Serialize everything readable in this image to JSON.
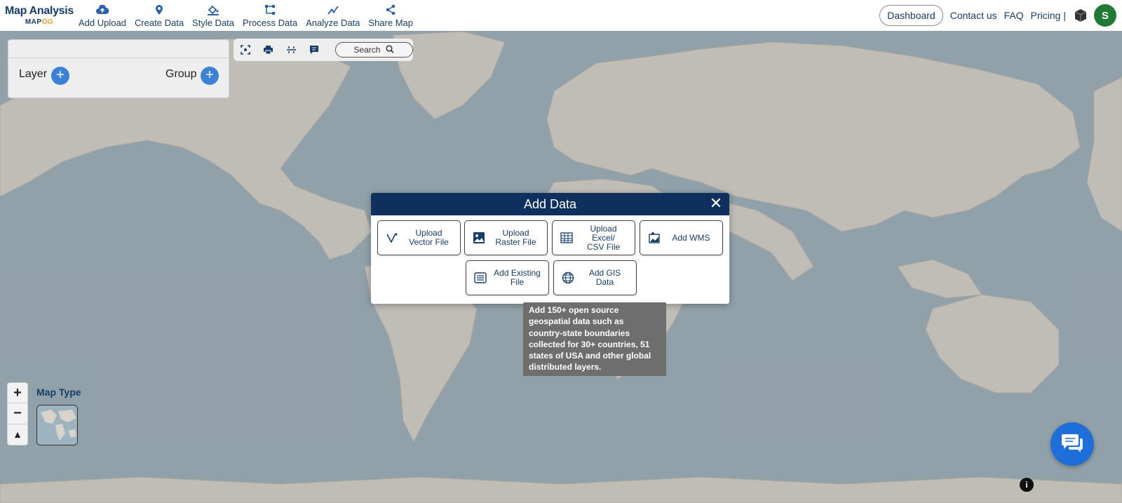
{
  "brand": {
    "title": "Map Analysis",
    "sub_main": "MAP",
    "sub_accent": "OG"
  },
  "nav": {
    "items": [
      {
        "label": "Add Upload",
        "icon": "cloud-upload-icon"
      },
      {
        "label": "Create Data",
        "icon": "map-pin-icon"
      },
      {
        "label": "Style Data",
        "icon": "paint-bucket-icon"
      },
      {
        "label": "Process Data",
        "icon": "process-icon"
      },
      {
        "label": "Analyze Data",
        "icon": "analyze-icon"
      },
      {
        "label": "Share Map",
        "icon": "share-icon"
      }
    ],
    "dashboard": "Dashboard",
    "contact": "Contact us",
    "faq": "FAQ",
    "pricing": "Pricing |",
    "avatar_initial": "S"
  },
  "layer_panel": {
    "layer_label": "Layer",
    "group_label": "Group"
  },
  "toolbar": {
    "search_label": "Search"
  },
  "map_type": {
    "label": "Map Type"
  },
  "zoom": {
    "in": "+",
    "out": "−",
    "north": "▲"
  },
  "modal": {
    "title": "Add Data",
    "close": "✕",
    "options": [
      {
        "label_line1": "Upload",
        "label_line2": "Vector File",
        "icon": "vector-icon"
      },
      {
        "label_line1": "Upload",
        "label_line2": "Raster File",
        "icon": "raster-image-icon"
      },
      {
        "label_line1": "Upload Excel/",
        "label_line2": "CSV File",
        "icon": "spreadsheet-icon"
      },
      {
        "label_line1": "Add WMS",
        "label_line2": "",
        "icon": "wms-icon"
      },
      {
        "label_line1": "Add Existing",
        "label_line2": "File",
        "icon": "database-icon"
      },
      {
        "label_line1": "Add GIS Data",
        "label_line2": "",
        "icon": "globe-icon"
      }
    ]
  },
  "tooltip": {
    "lines": [
      "Add 150+ open source",
      "geospatial data such as",
      "country-state boundaries",
      "collected for 30+ countries, 51",
      "states of USA and other global",
      "distributed layers."
    ]
  },
  "info_glyph": "i",
  "colors": {
    "brand": "#163d6b",
    "header": "#0f2f5f",
    "accent": "#3b82d6",
    "ocean": "#a7bdc8",
    "land": "#e6e1da",
    "chat": "#1e6fd9",
    "avatar": "#1f7a36",
    "tooltip": "#6e6e6e"
  }
}
